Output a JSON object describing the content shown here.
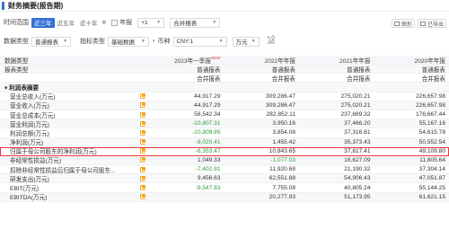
{
  "header": {
    "title": "财务摘要(报告期)",
    "pic_btn": "图形",
    "excel_btn": "已导出"
  },
  "filters": {
    "time_range_label": "时间范围",
    "ranges": [
      "近三年",
      "近五年",
      "近十年"
    ],
    "year_report_label": "年报",
    "plus": "+1",
    "merge": "合并报表",
    "data_type_label": "数据类型",
    "data_type": "普通报表",
    "index_type_label": "指标类型",
    "index_type": "基础数据",
    "currency_label": "币种",
    "currency": "CNY:1",
    "unit": "万元",
    "decimals_top": "+.0",
    "decimals_bottom": ".00"
  },
  "table": {
    "headers": [
      "数据类型",
      "2023年一季报",
      "2022年年报",
      "2021年年报",
      "2020年年报"
    ],
    "new_badge": "NEW",
    "rows": [
      {
        "label": "报表类型",
        "values": [
          "普通报表",
          "普通报表",
          "普通报表",
          "普通报表"
        ],
        "alt": true
      },
      {
        "label": "",
        "values": [
          "合并报表",
          "合并报表",
          "合并报表",
          "合并报表"
        ]
      },
      {
        "label": "利润表摘要",
        "values": [
          "",
          "",
          "",
          ""
        ],
        "section": true,
        "alt": true
      },
      {
        "label": "营业总收入(万元)",
        "values": [
          "44,917.29",
          "309,286.47",
          "275,020.21",
          "226,657.98"
        ],
        "icon": true
      },
      {
        "label": "营业收入(万元)",
        "values": [
          "44,917.29",
          "309,286.47",
          "275,020.21",
          "226,657.98"
        ],
        "icon": true,
        "alt": true
      },
      {
        "label": "营业总成本(万元)",
        "values": [
          "58,542.34",
          "282,852.11",
          "237,889.32",
          "176,667.44"
        ],
        "icon": true
      },
      {
        "label": "营业利润(万元)",
        "values": [
          "-10,807.31",
          "3,950.16",
          "37,466.20",
          "55,167.16"
        ],
        "icon": true,
        "alt": true
      },
      {
        "label": "利润总额(万元)",
        "values": [
          "-10,809.85",
          "3,854.08",
          "37,316.81",
          "54,615.78"
        ],
        "icon": true
      },
      {
        "label": "净利润(万元)",
        "values": [
          "-9,020.41",
          "1,455.42",
          "35,373.43",
          "50,552.54"
        ],
        "icon": true,
        "alt": true
      },
      {
        "label": "归属于母公司股东的净利润(万元)",
        "values": [
          "-6,353.47",
          "10,843.65",
          "37,817.41",
          "49,109.80"
        ],
        "icon": true,
        "highlight": true
      },
      {
        "label": "非经常性损益(万元)",
        "values": [
          "1,049.33",
          "-1,077.03",
          "16,627.09",
          "11,805.64"
        ],
        "icon": true,
        "alt": true
      },
      {
        "label": "扣除非经常性损益后归属于母公司股东...",
        "values": [
          "-7,402.81",
          "11,920.68",
          "21,190.32",
          "37,304.14"
        ],
        "icon": true
      },
      {
        "label": "研发支出(万元)",
        "values": [
          "9,456.63",
          "62,551.88",
          "54,906.43",
          "47,051.87"
        ],
        "icon": true,
        "alt": true
      },
      {
        "label": "EBIT(万元)",
        "values": [
          "-9,547.83",
          "7,755.08",
          "40,805.24",
          "55,144.25"
        ],
        "icon": true
      },
      {
        "label": "EBITDA(万元)",
        "values": [
          "",
          "20,277.93",
          "51,173.95",
          "61,621.15"
        ],
        "icon": true,
        "alt": true
      }
    ]
  }
}
